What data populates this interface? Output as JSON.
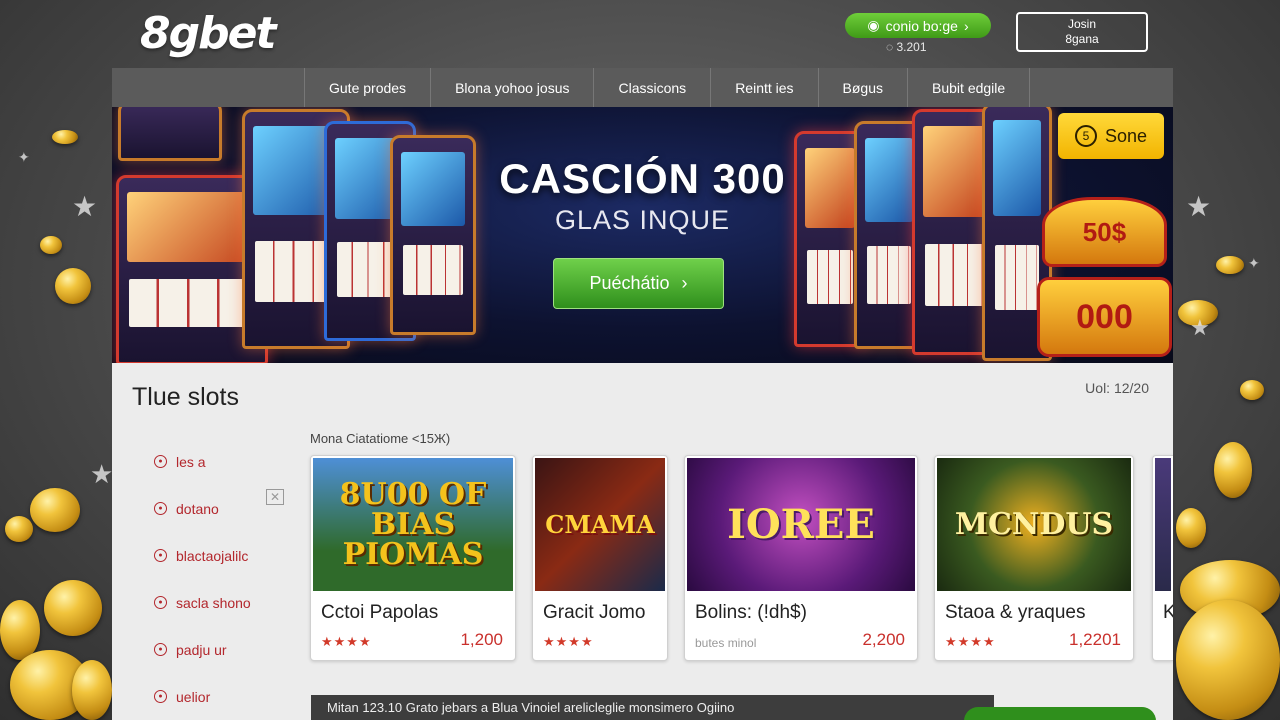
{
  "header": {
    "logo": "8gbet",
    "promo_button": "conio bo:ge",
    "promo_count": "3.201",
    "join_line1": "Josin",
    "join_line2": "8gana"
  },
  "nav": {
    "items": [
      "Gute prodes",
      "Blona yohoo josus",
      "Classicons",
      "Reintt ies",
      "Bøgus",
      "Bubit edgile"
    ]
  },
  "banner": {
    "title": "CASCIÓN 300",
    "subtitle": "GLAS INQUE",
    "cta": "Puéchátio",
    "badge": "Sone",
    "sign_top": "50$",
    "sign_bottom": "000"
  },
  "section": {
    "title": "Tlue slots",
    "page_indicator": "Uol: 12/20",
    "cards_label": "Mona Ciatatiome  <15Ж)"
  },
  "sidebar": {
    "items": [
      "les a",
      "dotano",
      "blactaojalilc",
      "sacla shono",
      "padju ur",
      "uelior"
    ]
  },
  "games": [
    {
      "thumb": "8U00 OF BIAS PIOMAS",
      "name": "Cctoi Papolas",
      "stars": "★★★★",
      "count": "1,200",
      "sub": ""
    },
    {
      "thumb": "CMAMA",
      "name": "Gracit Jomo",
      "stars": "★★★★",
      "count": "",
      "sub": ""
    },
    {
      "thumb": "IOREE",
      "name": "Bolins: (!dh$)",
      "stars": "",
      "count": "2,200",
      "sub": "butes minol"
    },
    {
      "thumb": "MCNDUS",
      "name": "Staoa & yraques",
      "stars": "★★★★",
      "count": "1,2201",
      "sub": ""
    },
    {
      "thumb": "",
      "name": "K",
      "stars": "",
      "count": "",
      "sub": ""
    }
  ],
  "ticker": "Mitan 123.10 Grato jebars a Blua Vinoiel arelicleglie monsimero Ogiino",
  "colors": {
    "accent_green": "#3f9a17",
    "accent_red": "#c9302c",
    "badge_yellow": "#f2b400",
    "nav_bg": "#5b5b5b"
  }
}
